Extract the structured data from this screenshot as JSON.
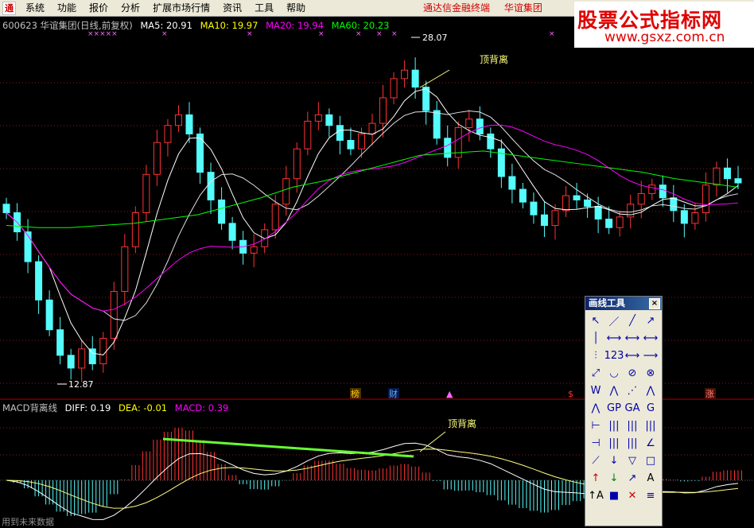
{
  "menubar": {
    "logo_text": "通",
    "items": [
      "系统",
      "功能",
      "报价",
      "分析",
      "扩展市场行情",
      "资讯",
      "工具",
      "帮助"
    ],
    "right_links": [
      "通达信金融终端",
      "华谊集团"
    ]
  },
  "watermark": {
    "title": "股票公式指标网",
    "url": "www.gsxz.com.cn"
  },
  "price_panel": {
    "code_name": "600623 华谊集团(日线,前复权)",
    "ma5": "MA5: 20.91",
    "ma10": "MA10: 19.97",
    "ma20": "MA20: 19.94",
    "ma60": "MA60: 20.23",
    "high_label": "28.07",
    "low_label": "12.87",
    "annotation": "顶背离"
  },
  "macd_panel": {
    "name": "MACD背离线",
    "diff": "DIFF: 0.19",
    "dea": "DEA: -0.01",
    "macd": "MACD: 0.39",
    "annotation": "顶背离"
  },
  "event_markers": [
    "榜",
    "财",
    "$",
    "涨"
  ],
  "draw_tools": {
    "title": "画线工具",
    "close": "×",
    "tools": [
      "↖",
      "／",
      "╱",
      "↗",
      "│",
      "⟷",
      "⟷",
      "⟷",
      "⫶",
      "123",
      "⟷",
      "⟶",
      "⤢",
      "◡",
      "⊘",
      "⊗",
      "W",
      "⋀",
      "⋰",
      "⋀",
      "⋀",
      "GP",
      "GA",
      "G",
      "⊢",
      "|||",
      "|||",
      "|||",
      "⊣",
      "|||",
      "|||",
      "∠",
      "⟋",
      "↓",
      "▽",
      "□",
      "↑",
      "↓",
      "↗",
      "A",
      "↑A",
      "■",
      "✕",
      "≡"
    ]
  },
  "status_text": "用到未来数据",
  "colors": {
    "ma5": "#ffffff",
    "ma10": "#ffff00",
    "ma20": "#ff00ff",
    "ma60": "#00ff00",
    "up": "#ff3232",
    "down": "#54fcfc",
    "menu_red": "#d00000"
  },
  "chart_data": {
    "type": "candlestick",
    "price": {
      "high_label_value": 28.07,
      "low_label_value": 12.87,
      "closes": [
        20.5,
        19.6,
        18.2,
        16.4,
        15.0,
        13.8,
        13.2,
        14.1,
        13.4,
        14.6,
        16.8,
        18.9,
        20.5,
        22.3,
        23.8,
        24.6,
        25.1,
        24.2,
        22.4,
        21.1,
        20.0,
        19.2,
        18.6,
        18.9,
        19.7,
        20.9,
        22.1,
        23.5,
        24.8,
        25.1,
        24.6,
        23.9,
        23.5,
        24.2,
        24.7,
        25.9,
        26.8,
        27.2,
        26.4,
        25.3,
        24.0,
        23.1,
        24.5,
        24.9,
        24.2,
        23.5,
        22.2,
        21.6,
        21.0,
        20.4,
        19.9,
        20.6,
        21.3,
        21.1,
        20.8,
        20.2,
        19.8,
        20.3,
        20.9,
        21.4,
        21.8,
        21.2,
        20.6,
        20.0,
        20.5,
        21.8,
        22.6,
        22.1,
        21.9
      ],
      "ma60_values": [
        19.9,
        19.8,
        19.8,
        19.9,
        20.0,
        20.2,
        20.4,
        20.8,
        21.2,
        21.7,
        22.0,
        22.4,
        22.8,
        23.2,
        23.3,
        23.4,
        23.2,
        23.0,
        22.8,
        22.6,
        22.4,
        22.1,
        21.9,
        21.7
      ]
    },
    "macd": {
      "diff": 0.19,
      "dea": -0.01,
      "macd": 0.39
    }
  }
}
